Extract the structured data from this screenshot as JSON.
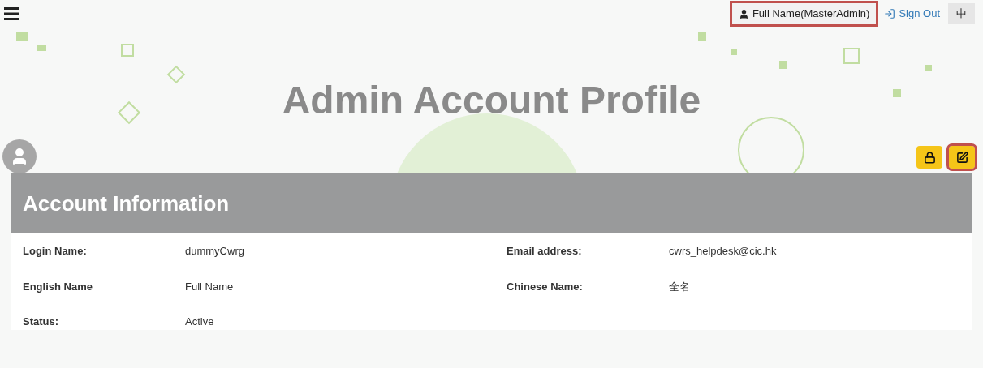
{
  "top_bar": {
    "user": {
      "label": "Full Name(MasterAdmin)",
      "highlighted": true
    },
    "sign_out": "Sign Out",
    "language": "中"
  },
  "page_title": "Admin Account Profile",
  "actions": [
    {
      "kind": "lock",
      "highlighted": false
    },
    {
      "kind": "edit",
      "highlighted": true
    }
  ],
  "card": {
    "title": "Account Information",
    "fields": [
      {
        "label": "Login Name:",
        "value": "dummyCwrg"
      },
      {
        "label": "Email address:",
        "value": "cwrs_helpdesk@cic.hk"
      },
      {
        "label": "English Name",
        "value": "Full Name"
      },
      {
        "label": "Chinese Name:",
        "value": "全名"
      },
      {
        "label": "Status:",
        "value": "Active"
      }
    ]
  }
}
